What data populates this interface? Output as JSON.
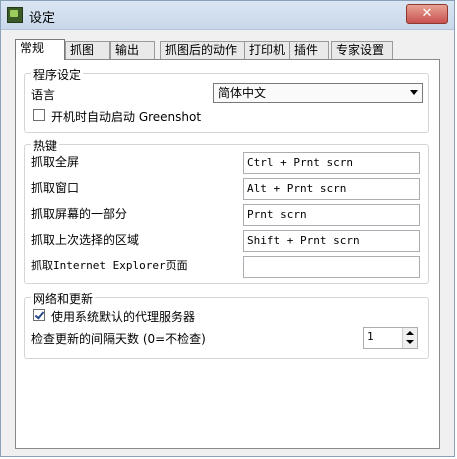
{
  "window": {
    "title": "设定",
    "close_label": "✕"
  },
  "tabs": [
    {
      "label": "常规"
    },
    {
      "label": "抓图"
    },
    {
      "label": "输出"
    },
    {
      "label": "抓图后的动作"
    },
    {
      "label": "打印机"
    },
    {
      "label": "插件"
    },
    {
      "label": "专家设置"
    }
  ],
  "program_settings": {
    "title": "程序设定",
    "language_label": "语言",
    "language_value": "简体中文",
    "autostart_label": "开机时自动启动 Greenshot",
    "autostart_checked": false
  },
  "hotkeys": {
    "title": "热键",
    "rows": [
      {
        "label": "抓取全屏",
        "value": "Ctrl + Prnt scrn"
      },
      {
        "label": "抓取窗口",
        "value": "Alt + Prnt scrn"
      },
      {
        "label": "抓取屏幕的一部分",
        "value": "Prnt scrn"
      },
      {
        "label": "抓取上次选择的区域",
        "value": "Shift + Prnt scrn"
      },
      {
        "label": "抓取Internet Explorer页面",
        "value": ""
      }
    ]
  },
  "network": {
    "title": "网络和更新",
    "proxy_label": "使用系统默认的代理服务器",
    "proxy_checked": true,
    "update_interval_label": "检查更新的间隔天数 (0=不检查)",
    "update_interval_value": "1"
  }
}
